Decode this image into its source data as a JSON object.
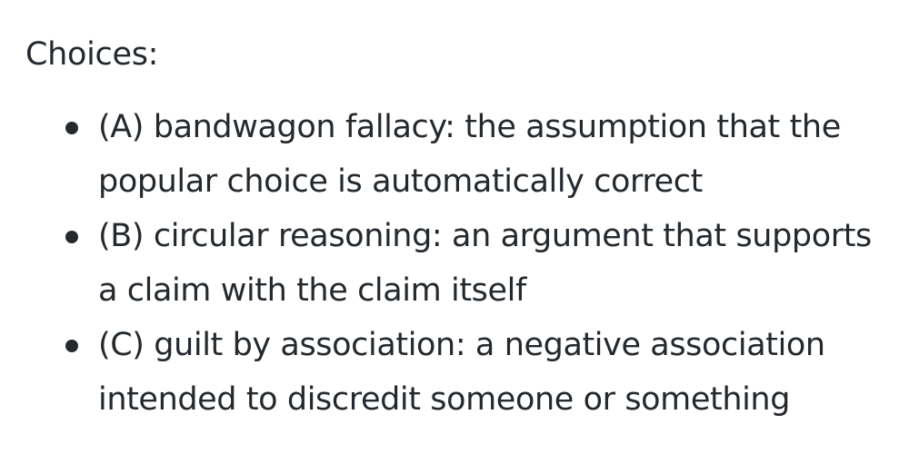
{
  "heading": "Choices:",
  "choices": [
    {
      "text": "(A) bandwagon fallacy: the assumption that the popular choice is automatically correct"
    },
    {
      "text": "(B) circular reasoning: an argument that supports a claim with the claim itself"
    },
    {
      "text": "(C) guilt by association: a negative association intended to discredit someone or something"
    }
  ],
  "colors": {
    "text": "#24292e",
    "background": "#ffffff"
  }
}
